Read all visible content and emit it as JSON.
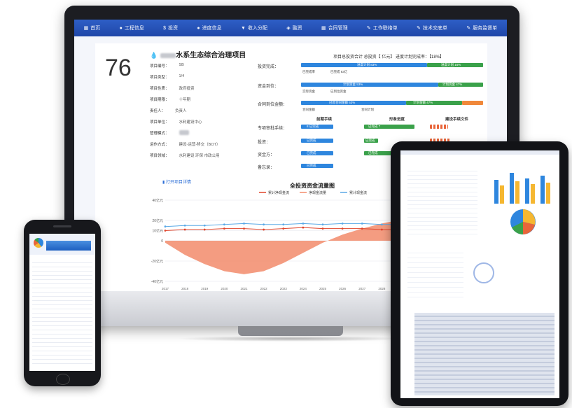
{
  "nav": {
    "items": [
      {
        "label": "首页",
        "icon": "grid-icon"
      },
      {
        "label": "工程信息",
        "icon": "drop-icon"
      },
      {
        "label": "投资",
        "icon": "dollar-icon"
      },
      {
        "label": "进度信息",
        "icon": "drop-icon"
      },
      {
        "label": "收入分配",
        "icon": "filter-icon"
      },
      {
        "label": "融资",
        "icon": "chart-icon"
      },
      {
        "label": "合同管理",
        "icon": "grid-icon"
      },
      {
        "label": "工作联络单",
        "icon": "pencil-icon"
      },
      {
        "label": "技术交底单",
        "icon": "pencil-icon"
      },
      {
        "label": "服务监督单",
        "icon": "pencil-icon"
      }
    ]
  },
  "project": {
    "score": "76",
    "title": "水系生态综合治理项目",
    "fields": [
      {
        "label": "项目编号：",
        "value": "SB"
      },
      {
        "label": "项目类型：",
        "value": "1/4"
      },
      {
        "label": "项目性质：",
        "value": "政府投资"
      },
      {
        "label": "项目期限：",
        "value": "十年期"
      },
      {
        "label": "责任人：",
        "value": "负责人"
      },
      {
        "label": "项目单位：",
        "value": "水利建设中心"
      },
      {
        "label": "管理模式：",
        "value": ""
      },
      {
        "label": "运作方式：",
        "value": "建设-运营-移交（BOT）"
      },
      {
        "label": "项目领域：",
        "value": "水利建设 环保 市政公用"
      }
    ],
    "view_button": "打开项目详情"
  },
  "progress": {
    "header": "项目总投资合计 总投资【 亿元】 进度计划完成率：【18%】",
    "rows": [
      {
        "label": "投资完成：",
        "bar_text": "进度计划 83%",
        "bar_text2": "进度计划 16%",
        "sub1": "已完成率",
        "sub2": "已完成 83亿"
      },
      {
        "label": "资金到位：",
        "bar_text": "计划资金 53%",
        "bar_text2": "计划资金 47%",
        "sub1": "实际资金",
        "sub2": "已到位资金"
      },
      {
        "label": "合同到位金额：",
        "bar_text": "已签合同金额 53%",
        "bar_text2": "计划金额 47%",
        "sub1": "合同金额",
        "sub2": "合同计划"
      }
    ],
    "columns": [
      "前期手续",
      "形象进度",
      "建设手续文件"
    ],
    "items": [
      {
        "label": "专项审批手续：",
        "c1": "8 已完成",
        "c2": "已完成 7"
      },
      {
        "label": "投资：",
        "c1": "已完成",
        "c2": "已完成"
      },
      {
        "label": "资金方：",
        "c1": "已完成",
        "c2": "已完成"
      },
      {
        "label": "备忘录：",
        "c1": "已完成",
        "c2": ""
      }
    ]
  },
  "chart_data": {
    "type": "line",
    "title": "全投资资金流量图",
    "legend": [
      "累计净现金流",
      "净现金流量",
      "累计现金流"
    ],
    "x": [
      "2017",
      "2018",
      "2019",
      "2020",
      "2021",
      "2022",
      "2023",
      "2024",
      "2025",
      "2026",
      "2027",
      "2028",
      "2029",
      "2030",
      "2031",
      "2032",
      "2033"
    ],
    "yticks": [
      "40亿元",
      "20亿元",
      "10亿元",
      "0",
      "-20亿元",
      "-40亿元"
    ],
    "ylim": [
      -40,
      40
    ],
    "series": [
      {
        "name": "累计净现金流",
        "values": [
          -2,
          -14,
          -23,
          -30,
          -33,
          -30,
          -22,
          -12,
          -2,
          6,
          12,
          17,
          21,
          24,
          27,
          29,
          31
        ]
      },
      {
        "name": "净现金流量",
        "values": [
          10,
          11,
          11,
          12,
          12,
          11,
          12,
          13,
          12,
          12,
          12,
          11,
          11,
          12,
          13,
          12,
          12
        ]
      },
      {
        "name": "累计现金流",
        "values": [
          14,
          15,
          15,
          16,
          17,
          16,
          16,
          17,
          16,
          17,
          17,
          16,
          16,
          17,
          18,
          17,
          17
        ]
      }
    ],
    "colors": {
      "area": "#f28b6b",
      "line1": "#e0442a",
      "line2": "#5aa9e6"
    }
  }
}
